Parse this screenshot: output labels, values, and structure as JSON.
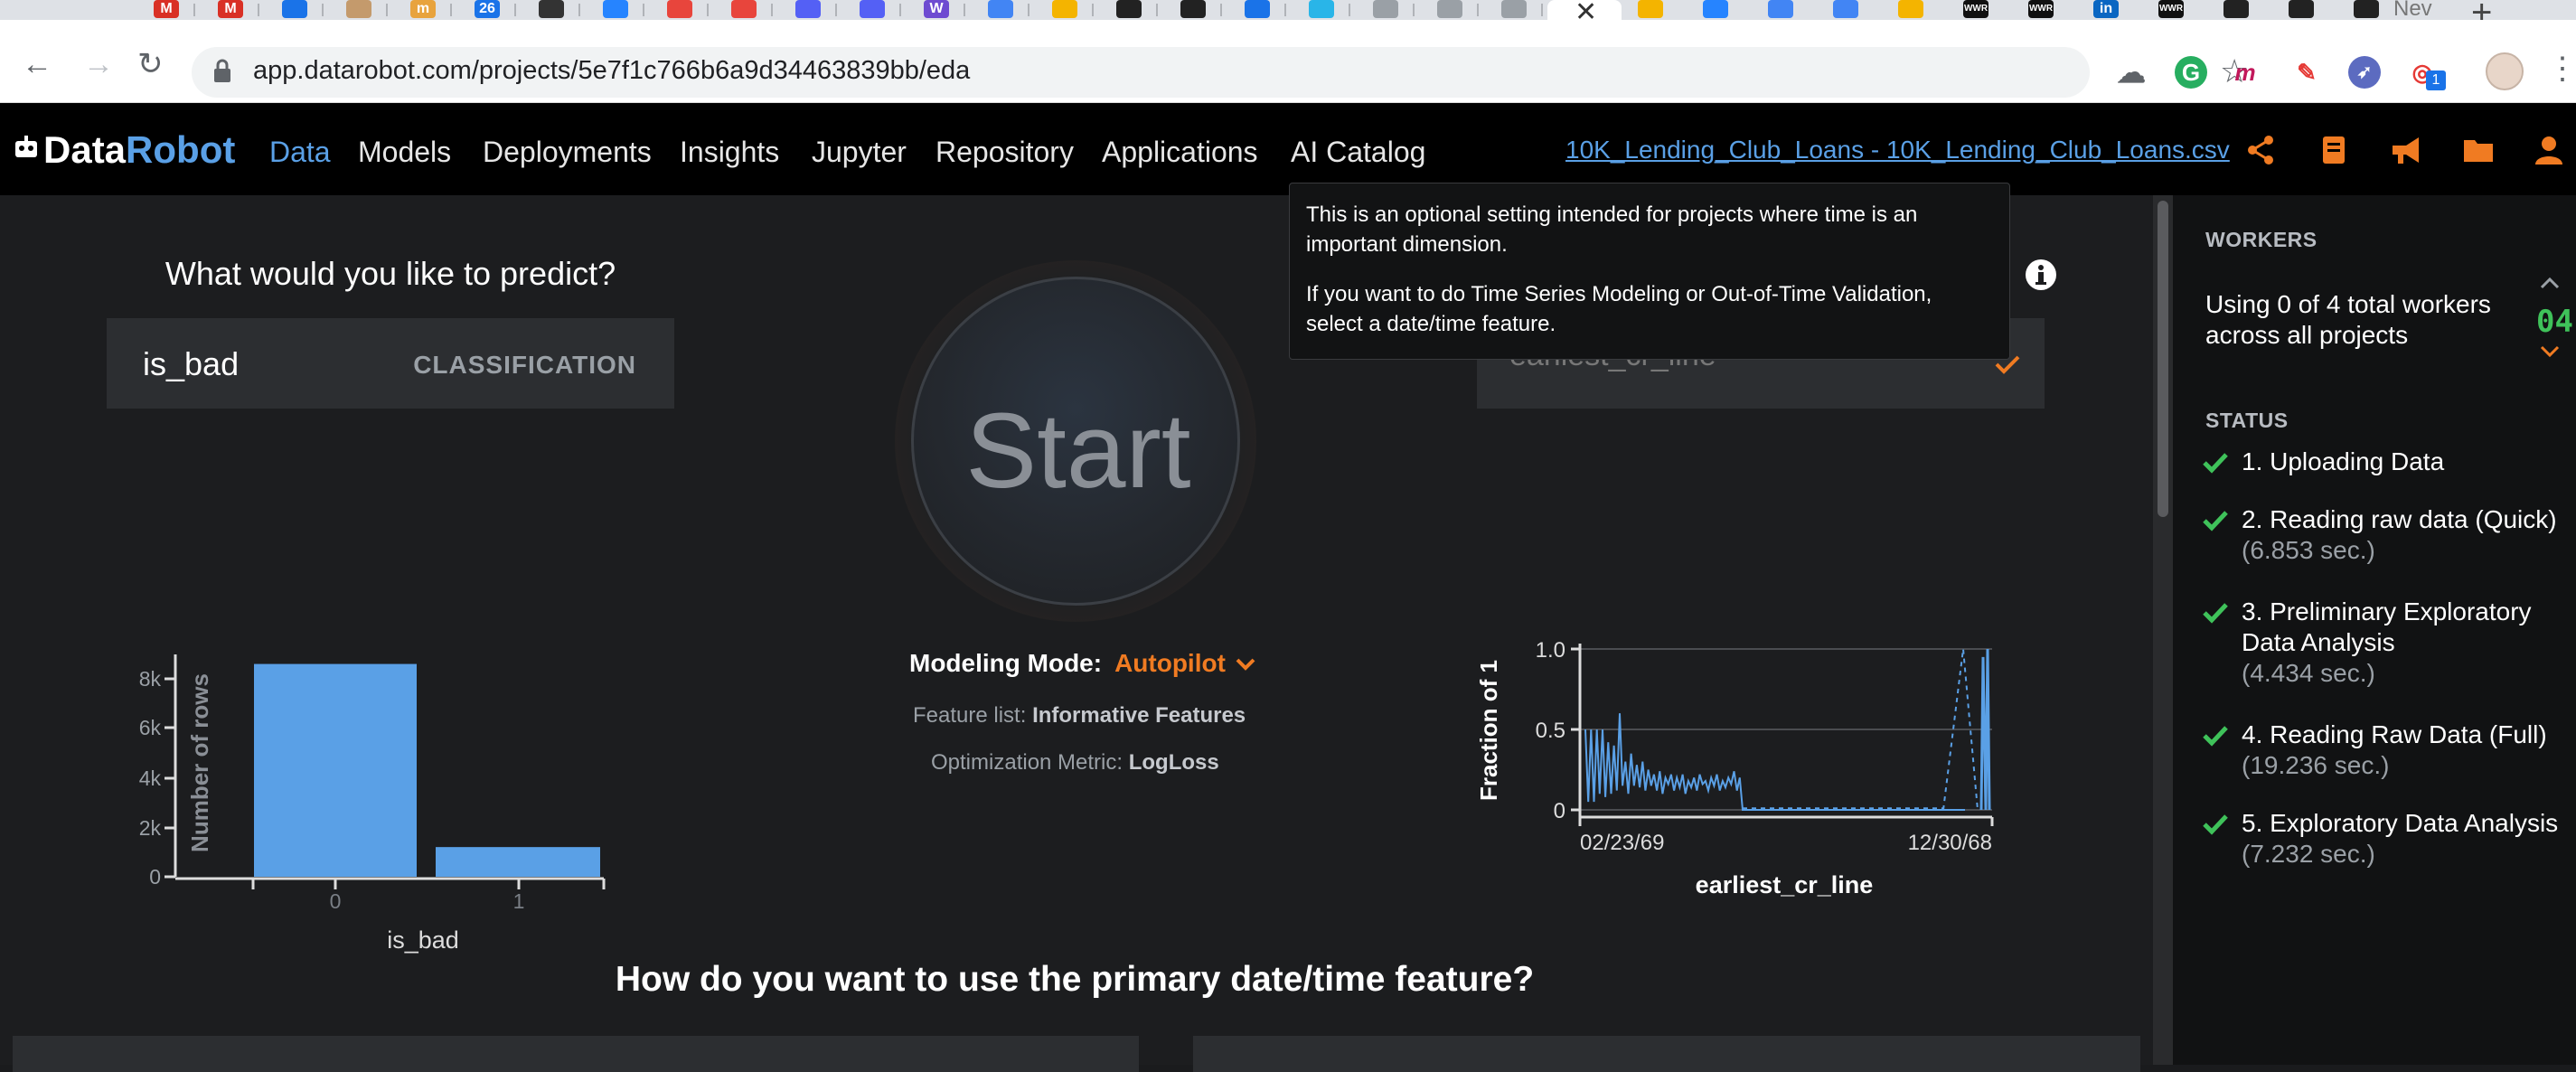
{
  "browser": {
    "url": "app.datarobot.com/projects/5e7f1c766b6a9d34463839bb/eda",
    "tab_badge": "26",
    "new_tab_partial": "Nev",
    "ext_badge": "1",
    "pinned_tabs": [
      "gmail",
      "gmail",
      "circle-blue",
      "avatar",
      "m-orange",
      "calendar",
      "dark-circle",
      "jira",
      "flame-red",
      "flame-red",
      "aws-blue",
      "aws-blue",
      "w-purple",
      "docs",
      "slides",
      "stripes",
      "stripes",
      "circle-blue",
      "snowflake",
      "robot",
      "robot",
      "robot"
    ],
    "tabs_right": [
      "slides",
      "jira",
      "docs",
      "docs",
      "slides",
      "wwr",
      "wwr",
      "linkedin",
      "wwr",
      "dark",
      "github",
      "github"
    ],
    "wwr_label": "WWR"
  },
  "header": {
    "logo_data": "Data",
    "logo_robot": "Robot",
    "nav": [
      {
        "label": "Data",
        "active": true
      },
      {
        "label": "Models"
      },
      {
        "label": "Deployments"
      },
      {
        "label": "Insights"
      },
      {
        "label": "Jupyter"
      },
      {
        "label": "Repository"
      },
      {
        "label": "Applications"
      },
      {
        "label": "AI Catalog"
      }
    ],
    "project_link": "10K_Lending_Club_Loans - 10K_Lending_Club_Loans.csv",
    "icons": [
      "share-icon",
      "notebook-icon",
      "megaphone-icon",
      "folder-icon",
      "user-icon"
    ],
    "accent": "#f07b22",
    "brand_blue": "#5aa0e6"
  },
  "target": {
    "heading": "What would you like to predict?",
    "name": "is_bad",
    "type": "CLASSIFICATION"
  },
  "histogram": {
    "chart_data": {
      "type": "bar",
      "categories": [
        "0",
        "1"
      ],
      "values": [
        8600,
        1200
      ],
      "ylabel": "Number of rows",
      "xlabel": "is_bad",
      "yticks": [
        "0",
        "2k",
        "4k",
        "6k",
        "8k"
      ],
      "ylim": [
        0,
        9000
      ],
      "bar_color": "#5aa0e6"
    }
  },
  "start": {
    "label": "Start",
    "mode_label": "Modeling Mode:",
    "mode_value": "Autopilot",
    "featurelist_label": "Feature list:",
    "featurelist_value": "Informative Features",
    "metric_label": "Optimization Metric:",
    "metric_value": "LogLoss"
  },
  "datetime": {
    "selected": "earliest_cr_line",
    "tooltip_p1": "This is an optional setting intended for projects where time is an important dimension.",
    "tooltip_p2": "If you want to do Time Series Modeling or Out-of-Time Validation, select a date/time feature.",
    "chart_data": {
      "type": "line",
      "xlabel": "earliest_cr_line",
      "ylabel": "Fraction of 1",
      "xticks": [
        "02/23/69",
        "12/30/68"
      ],
      "yticks": [
        "0",
        "0.5",
        "1.0"
      ],
      "ylim": [
        0,
        1
      ],
      "segments": [
        0.5,
        0.05,
        0.5,
        0.05,
        0.5,
        0.1,
        0.5,
        0.08,
        0.42,
        0.1,
        0.4,
        0.12,
        0.6,
        0.15,
        0.3,
        0.1,
        0.35,
        0.15,
        0.28,
        0.14,
        0.3,
        0.12,
        0.25,
        0.15,
        0.22,
        0.12,
        0.24,
        0.1,
        0.2,
        0.16,
        0.22,
        0.12,
        0.2,
        0.14,
        0.22,
        0.1,
        0.18,
        0.14,
        0.2,
        0.12,
        0.22,
        0.16,
        0.18,
        0.12,
        0.2,
        0.15,
        0.22,
        0.12,
        0.18,
        0.14,
        0.2,
        0.16,
        0.24,
        0.12,
        0.2,
        0.0
      ],
      "dashed_peaks": [
        1.0,
        0.95
      ],
      "line_color": "#5aa0e6"
    }
  },
  "bottom": {
    "heading": "How do you want to use the primary date/time feature?"
  },
  "side": {
    "workers_title": "WORKERS",
    "workers_text": "Using 0 of 4 total workers across all projects",
    "workers_count": "04",
    "status_title": "STATUS",
    "steps": [
      {
        "label": "1. Uploading Data",
        "time": ""
      },
      {
        "label": "2. Reading raw data (Quick)",
        "time": "(6.853 sec.)"
      },
      {
        "label": "3. Preliminary Exploratory Data Analysis",
        "time": "(4.434 sec.)"
      },
      {
        "label": "4. Reading Raw Data (Full)",
        "time": "(19.236 sec.)"
      },
      {
        "label": "5. Exploratory Data Analysis",
        "time": "(7.232 sec.)"
      }
    ],
    "check_color": "#3fc25a"
  }
}
